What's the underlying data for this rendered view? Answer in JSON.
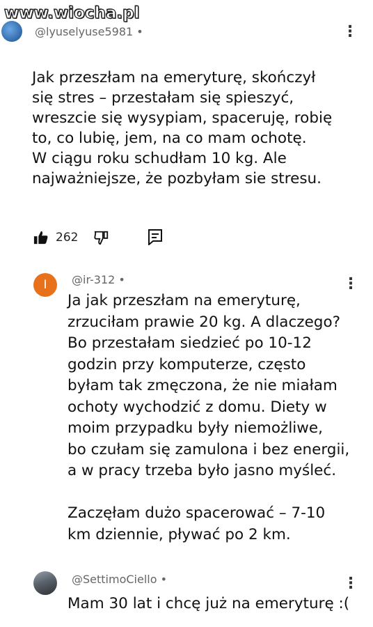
{
  "watermark": "www.wiocha.pl",
  "comments": [
    {
      "handle": "@lyuselyuse5981 •",
      "text": "Jak przeszłam na emeryturę, skończył\nsię stres – przestałam się spieszyć,\nwreszcie się wysypiam, spaceruję, robię\nto, co lubię, jem, na co mam ochotę.\nW ciągu roku schudłam 10 kg. Ale\nnajważniejsze, że pozbyłam sie stresu.",
      "likes": "262"
    },
    {
      "avatar_letter": "I",
      "handle": "@ir-312 •",
      "text": "Ja jak przeszłam na emeryturę,\nzrzuciłam prawie 20 kg. A dlaczego?\nBo przestałam siedzieć po 10-12\ngodzin przy komputerze, często\nbyłam tak zmęczona, że nie miałam\nochoty wychodzić z domu. Diety w\nmoim przypadku były niemożliwe,\nbo czułam się zamulona i bez energii,\na w pracy trzeba było jasno myśleć.\n\nZaczęłam dużo spacerować – 7-10\nkm dziennie, pływać po 2 km."
    },
    {
      "handle": "@SettimoCiello •",
      "text": "Mam 30 lat i chcę już na emeryturę :("
    }
  ],
  "icons": {
    "like": "thumbs-up-icon",
    "dislike": "thumbs-down-icon",
    "reply": "reply-icon",
    "more": "more-vertical-icon"
  },
  "colors": {
    "avatar_ir": "#e8711b"
  }
}
